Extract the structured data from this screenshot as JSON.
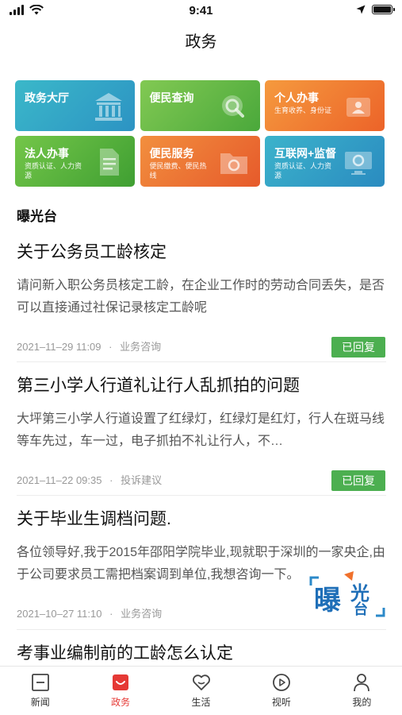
{
  "status_bar": {
    "time": "9:41"
  },
  "header": {
    "title": "政务"
  },
  "services": [
    {
      "label": "政务大厅",
      "sub": "",
      "color_from": "#39b3c9",
      "color_to": "#2f97c4",
      "icon": "government-hall-icon"
    },
    {
      "label": "便民查询",
      "sub": "",
      "color_from": "#7bc64f",
      "color_to": "#4faa3c",
      "icon": "search-icon"
    },
    {
      "label": "个人办事",
      "sub": "生育收养、身份证",
      "color_from": "#f4923a",
      "color_to": "#ef6a2b",
      "icon": "id-card-icon"
    },
    {
      "label": "法人办事",
      "sub": "资质认证、人力资源",
      "color_from": "#6ec245",
      "color_to": "#43a334",
      "icon": "document-icon"
    },
    {
      "label": "便民服务",
      "sub": "便民缴费、便民热线",
      "color_from": "#f08a3c",
      "color_to": "#e9612e",
      "icon": "folder-icon"
    },
    {
      "label": "互联网+监督",
      "sub": "资质认证、人力资源",
      "color_from": "#39b0cc",
      "color_to": "#2b8fc2",
      "icon": "monitor-icon"
    }
  ],
  "section": {
    "title": "曝光台"
  },
  "posts": [
    {
      "title": "关于公务员工龄核定",
      "body": "请问新入职公务员核定工龄，在企业工作时的劳动合同丢失，是否可以直接通过社保记录核定工龄呢",
      "date": "2021–11–29 11:09",
      "category": "业务咨询",
      "status": "已回复"
    },
    {
      "title": "第三小学人行道礼让行人乱抓拍的问题",
      "body": "大坪第三小学人行道设置了红绿灯，红绿灯是红灯，行人在斑马线等车先过，车一过，电子抓拍不礼让行人，不…",
      "date": "2021–11–22 09:35",
      "category": "投诉建议",
      "status": "已回复"
    },
    {
      "title": "关于毕业生调档问题.",
      "body": "各位领导好,我于2015年邵阳学院毕业,现就职于深圳的一家央企,由于公司要求员工需把档案调到单位,我想咨询一下。",
      "date": "2021–10–27 11:10",
      "category": "业务咨询",
      "status": ""
    },
    {
      "title": "考事业编制前的工龄怎么认定",
      "body": "",
      "date": "",
      "category": "",
      "status": ""
    }
  ],
  "meta_separator": "·",
  "logo": {
    "text_top": "光",
    "text_main": "曝",
    "text_sub": "台"
  },
  "tabs": [
    {
      "label": "新闻",
      "icon": "news-icon",
      "active": false
    },
    {
      "label": "政务",
      "icon": "government-icon",
      "active": true
    },
    {
      "label": "生活",
      "icon": "heart-icon",
      "active": false
    },
    {
      "label": "视听",
      "icon": "play-icon",
      "active": false
    },
    {
      "label": "我的",
      "icon": "profile-icon",
      "active": false
    }
  ],
  "colors": {
    "accent": "#e53935",
    "reply_badge": "#4caf50"
  }
}
